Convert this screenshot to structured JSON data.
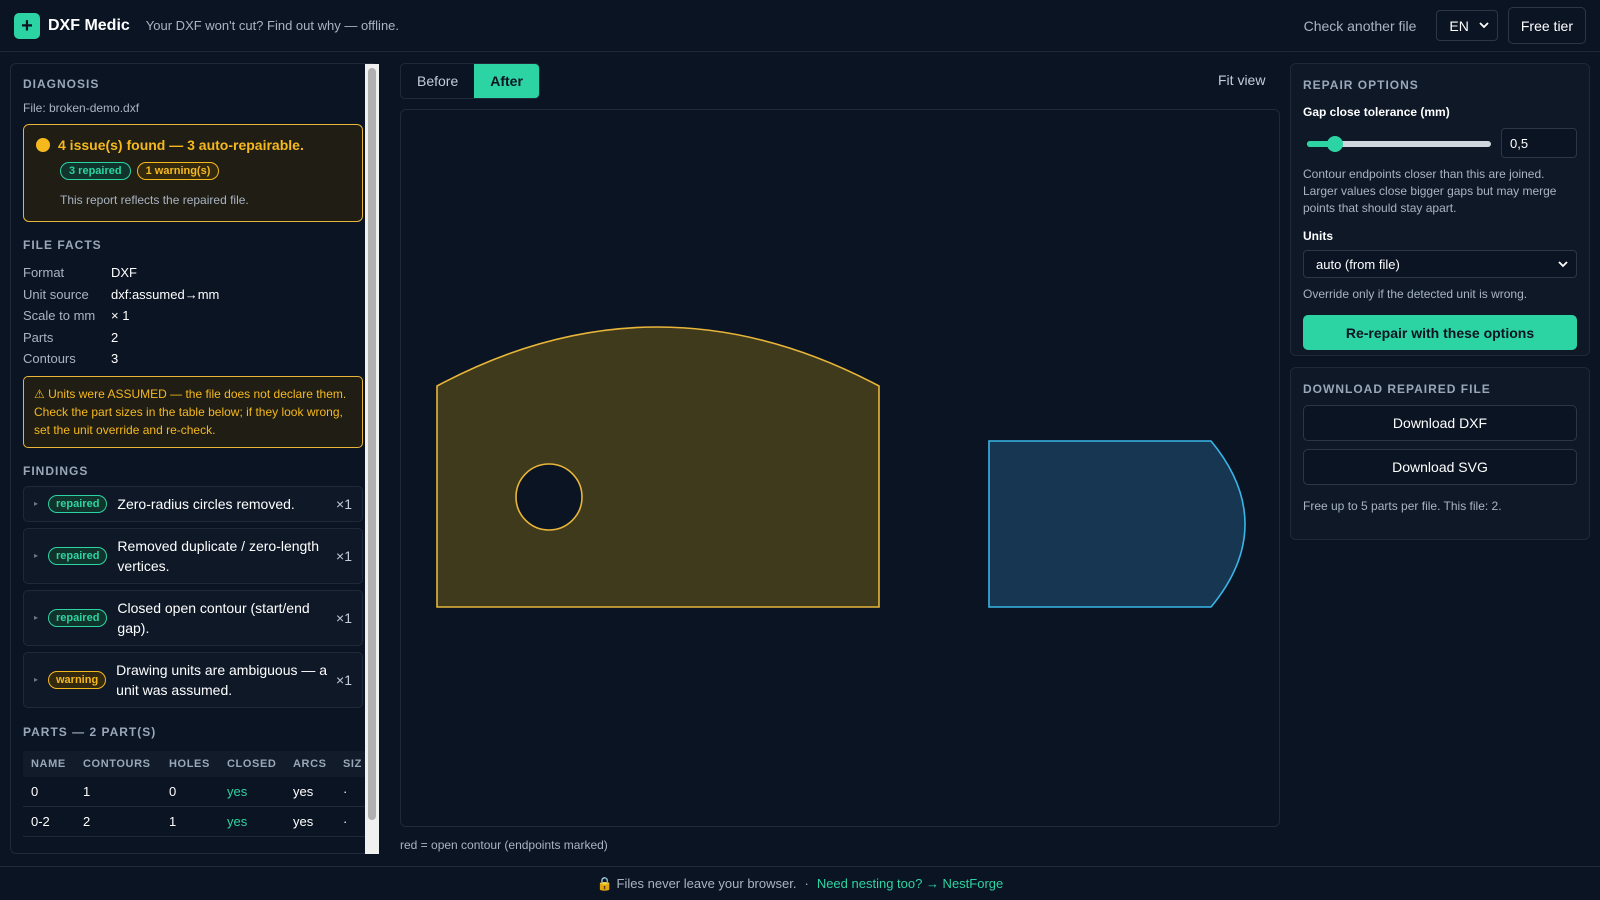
{
  "header": {
    "logo_glyph": "+",
    "app_name": "DXF Medic",
    "tagline": "Your DXF won't cut? Find out why — offline.",
    "check_link": "Check another file",
    "language": "EN",
    "tier_button": "Free tier"
  },
  "diagnosis": {
    "title": "DIAGNOSIS",
    "file_label": "File: broken-demo.dxf",
    "summary": "4 issue(s) found — 3 auto-repairable.",
    "pill_repaired": "3 repaired",
    "pill_warnings": "1 warning(s)",
    "report_note": "This report reflects the repaired file.",
    "summary_color": "#f5b91e"
  },
  "file_facts": {
    "title": "FILE FACTS",
    "rows": [
      {
        "key": "Format",
        "value": "DXF"
      },
      {
        "key": "Unit source",
        "value": "dxf:assumed→mm"
      },
      {
        "key": "Scale to mm",
        "value": "× 1"
      },
      {
        "key": "Parts",
        "value": "2"
      },
      {
        "key": "Contours",
        "value": "3"
      }
    ],
    "units_warning": "⚠ Units were ASSUMED — the file does not declare them. Check the part sizes in the table below; if they look wrong, set the unit override and re-check."
  },
  "findings": {
    "title": "FINDINGS",
    "items": [
      {
        "status": "repaired",
        "text": "Zero-radius circles removed.",
        "count": "×1"
      },
      {
        "status": "repaired",
        "text": "Removed duplicate / zero-length vertices.",
        "count": "×1"
      },
      {
        "status": "repaired",
        "text": "Closed open contour (start/end gap).",
        "count": "×1"
      },
      {
        "status": "warning",
        "text": "Drawing units are ambiguous — a unit was assumed.",
        "count": "×1"
      }
    ]
  },
  "parts": {
    "title": "PARTS — 2 PART(S)",
    "columns": [
      "NAME",
      "CONTOURS",
      "HOLES",
      "CLOSED",
      "ARCS",
      "SIZ"
    ],
    "rows": [
      [
        "0",
        "1",
        "0",
        "yes",
        "yes",
        "·"
      ],
      [
        "0-2",
        "2",
        "1",
        "yes",
        "yes",
        "·"
      ]
    ]
  },
  "view": {
    "tab_before": "Before",
    "tab_after": "After",
    "active_tab": "After",
    "fit_view": "Fit view",
    "legend_note": "red = open contour (endpoints marked)",
    "part_colors": {
      "part_a": "#e8b53a",
      "part_b": "#38b6e8"
    }
  },
  "repair_options": {
    "title": "REPAIR OPTIONS",
    "tolerance_label": "Gap close tolerance (mm)",
    "tolerance_value": "0,5",
    "tolerance_fraction": 0.12,
    "tolerance_help": "Contour endpoints closer than this are joined. Larger values close bigger gaps but may merge points that should stay apart.",
    "units_label": "Units",
    "units_value": "auto (from file)",
    "units_help": "Override only if the detected unit is wrong.",
    "rerepair_button": "Re-repair with these options"
  },
  "download": {
    "title": "DOWNLOAD REPAIRED FILE",
    "dxf_button": "Download DXF",
    "svg_button": "Download SVG",
    "free_note": "Free up to 5 parts per file. This file: 2."
  },
  "footer": {
    "privacy": "🔒 Files never leave your browser.",
    "separator": "·",
    "nesting_link": "Need nesting too? → NestForge"
  },
  "accent_color": "#2dd4a3"
}
